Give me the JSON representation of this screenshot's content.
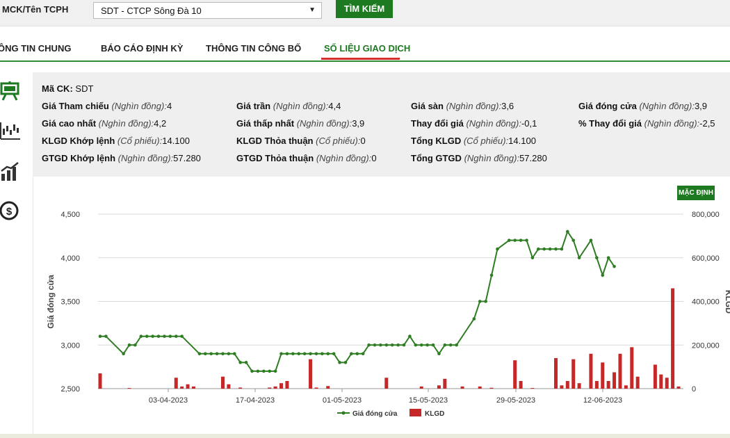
{
  "search": {
    "label": "MCK/Tên TCPH",
    "selected": "SDT - CTCP Sông Đà 10",
    "button": "TÌM KIẾM"
  },
  "nav": {
    "tabs": [
      "ÔNG TIN CHUNG",
      "BÁO CÁO ĐỊNH KỲ",
      "THÔNG TIN CÔNG BỐ",
      "SỐ LIỆU GIAO DỊCH"
    ],
    "active": 3
  },
  "rail_icons": [
    "presentation-board-icon",
    "candlestick-chart-icon",
    "growth-chart-icon",
    "dollar-coin-icon"
  ],
  "info": {
    "code_label": "Mã CK:",
    "code": "SDT",
    "rows": [
      [
        {
          "label": "Giá Tham chiếu",
          "unit": "(Nghìn đồng):",
          "value": "4"
        },
        {
          "label": "Giá trần",
          "unit": "(Nghìn đồng):",
          "value": "4,4"
        },
        {
          "label": "Giá sàn",
          "unit": "(Nghìn đồng):",
          "value": "3,6"
        },
        {
          "label": "Giá đóng cửa",
          "unit": "(Nghìn đồng):",
          "value": "3,9"
        }
      ],
      [
        {
          "label": "Giá cao nhất",
          "unit": "(Nghìn đồng):",
          "value": "4,2"
        },
        {
          "label": "Giá thấp nhất",
          "unit": "(Nghìn đồng):",
          "value": "3,9"
        },
        {
          "label": "Thay đổi giá",
          "unit": "(Nghìn đồng):",
          "value": "-0,1"
        },
        {
          "label": "% Thay đổi giá",
          "unit": "(Nghìn đồng):",
          "value": "-2,5"
        }
      ],
      [
        {
          "label": "KLGD Khớp lệnh",
          "unit": "(Cổ phiếu):",
          "value": "14.100"
        },
        {
          "label": "KLGD Thỏa thuận",
          "unit": "(Cổ phiếu):",
          "value": "0"
        },
        {
          "label": "Tổng KLGD",
          "unit": "(Cổ phiếu):",
          "value": "14.100"
        },
        {
          "label": "",
          "unit": "",
          "value": ""
        }
      ],
      [
        {
          "label": "GTGD Khớp lệnh",
          "unit": "(Nghìn đồng):",
          "value": "57.280"
        },
        {
          "label": "GTGD Thỏa thuận",
          "unit": "(Nghìn đồng):",
          "value": "0"
        },
        {
          "label": "Tổng GTGD",
          "unit": "(Nghìn đồng):",
          "value": "57.280"
        },
        {
          "label": "",
          "unit": "",
          "value": ""
        }
      ]
    ]
  },
  "chart_button": "MẶC ĐỊNH",
  "colors": {
    "accent": "#1d7a21",
    "line": "#2e7d22",
    "bar": "#c62828",
    "nav_active": "#d32f2f"
  },
  "chart_data": {
    "type": "line+bar",
    "y_left_label": "Giá đóng cửa",
    "y_right_label": "KLGD",
    "y_left_ticks": [
      "2,500",
      "3,000",
      "3,500",
      "4,000",
      "4,500"
    ],
    "y_right_ticks": [
      "0",
      "200,000",
      "400,000",
      "600,000",
      "800,000"
    ],
    "ylim_left": [
      2500,
      4500
    ],
    "ylim_right": [
      0,
      800000
    ],
    "x_ticks": [
      {
        "label": "03-04-2023",
        "index": 9
      },
      {
        "label": "17-04-2023",
        "index": 19
      },
      {
        "label": "01-05-2023",
        "index": 29
      },
      {
        "label": "15-05-2023",
        "index": 39
      },
      {
        "label": "29-05-2023",
        "index": 49
      },
      {
        "label": "12-06-2023",
        "index": 59
      }
    ],
    "x_count": 70,
    "legend": [
      "Giá đóng cửa",
      "KLGD"
    ],
    "legend_position": "bottom",
    "series": [
      {
        "name": "Giá đóng cửa",
        "values": [
          3100,
          3100,
          null,
          null,
          2900,
          3000,
          3000,
          3100,
          3100,
          3100,
          3100,
          3100,
          3100,
          3100,
          3100,
          null,
          null,
          2900,
          2900,
          2900,
          2900,
          2900,
          2900,
          2900,
          2800,
          2800,
          2700,
          2700,
          2700,
          2700,
          2700,
          2900,
          2900,
          2900,
          2900,
          2900,
          2900,
          2900,
          2900,
          2900,
          2900,
          2800,
          2800,
          2900,
          2900,
          2900,
          3000,
          3000,
          3000,
          3000,
          3000,
          3000,
          3000,
          3100,
          3000,
          3000,
          3000,
          3000,
          2900,
          3000,
          3000,
          3000,
          null,
          null,
          3300,
          3500,
          3500,
          3800,
          4100,
          null,
          4200,
          4200,
          4200,
          4200,
          4000,
          4100,
          4100,
          4100,
          4100,
          4100,
          4300,
          4200,
          4000,
          null,
          4200,
          4000,
          3800,
          4000,
          3900
        ],
        "x_index": [
          0,
          1,
          null,
          null,
          4,
          5,
          6,
          7,
          8,
          9,
          10,
          11,
          12,
          13,
          14,
          null,
          null,
          17,
          18,
          19,
          20,
          21,
          22,
          23,
          24,
          25,
          26,
          27,
          28,
          29,
          30,
          31,
          32,
          33,
          34,
          35,
          36,
          37,
          38,
          39,
          40,
          41,
          42,
          43,
          44,
          45,
          46,
          47,
          48,
          49,
          50,
          51,
          52,
          53,
          54,
          55,
          56,
          57,
          58,
          59,
          60,
          61,
          null,
          null,
          64,
          65,
          66,
          67,
          68,
          null,
          70,
          71,
          72,
          73,
          74,
          75,
          76,
          77,
          78,
          79,
          80,
          81,
          82,
          null,
          84,
          85,
          86,
          87,
          88
        ]
      },
      {
        "name": "KLGD",
        "bars": [
          {
            "i": 0,
            "v": 70000
          },
          {
            "i": 5,
            "v": 3000
          },
          {
            "i": 13,
            "v": 50000
          },
          {
            "i": 14,
            "v": 10000
          },
          {
            "i": 15,
            "v": 20000
          },
          {
            "i": 16,
            "v": 10000
          },
          {
            "i": 21,
            "v": 55000
          },
          {
            "i": 22,
            "v": 20000
          },
          {
            "i": 24,
            "v": 5000
          },
          {
            "i": 29,
            "v": 5000
          },
          {
            "i": 30,
            "v": 10000
          },
          {
            "i": 31,
            "v": 25000
          },
          {
            "i": 32,
            "v": 35000
          },
          {
            "i": 36,
            "v": 135000
          },
          {
            "i": 37,
            "v": 5000
          },
          {
            "i": 39,
            "v": 12000
          },
          {
            "i": 49,
            "v": 50000
          },
          {
            "i": 55,
            "v": 10000
          },
          {
            "i": 58,
            "v": 15000
          },
          {
            "i": 59,
            "v": 45000
          },
          {
            "i": 62,
            "v": 10000
          },
          {
            "i": 65,
            "v": 10000
          },
          {
            "i": 67,
            "v": 4000
          },
          {
            "i": 71,
            "v": 130000
          },
          {
            "i": 72,
            "v": 35000
          },
          {
            "i": 74,
            "v": 3000
          },
          {
            "i": 78,
            "v": 140000
          },
          {
            "i": 79,
            "v": 15000
          },
          {
            "i": 80,
            "v": 35000
          },
          {
            "i": 81,
            "v": 135000
          },
          {
            "i": 82,
            "v": 25000
          },
          {
            "i": 84,
            "v": 160000
          },
          {
            "i": 85,
            "v": 35000
          },
          {
            "i": 86,
            "v": 120000
          },
          {
            "i": 87,
            "v": 35000
          },
          {
            "i": 88,
            "v": 75000
          },
          {
            "i": 89,
            "v": 160000
          },
          {
            "i": 90,
            "v": 15000
          },
          {
            "i": 91,
            "v": 190000
          },
          {
            "i": 92,
            "v": 55000
          },
          {
            "i": 95,
            "v": 110000
          },
          {
            "i": 96,
            "v": 65000
          },
          {
            "i": 97,
            "v": 50000
          },
          {
            "i": 98,
            "v": 460000
          },
          {
            "i": 99,
            "v": 10000
          }
        ]
      }
    ]
  }
}
